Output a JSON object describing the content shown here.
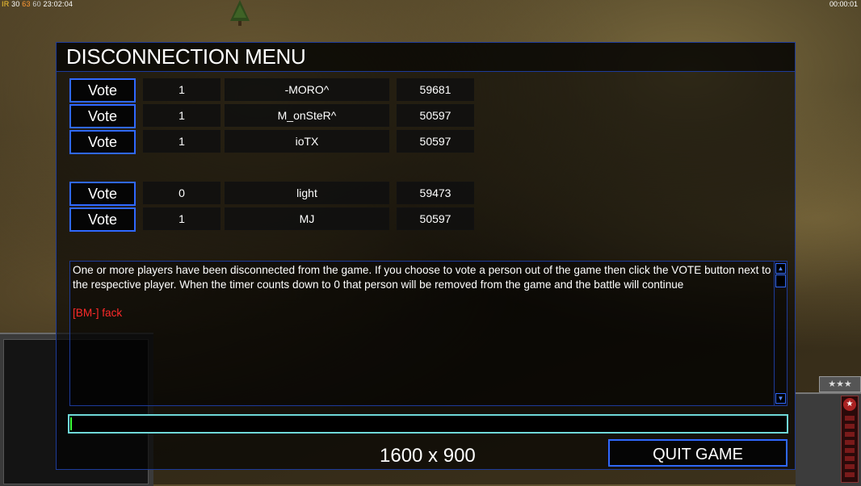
{
  "hud": {
    "stats": [
      "IR",
      "30",
      "63",
      "60",
      "23:02:04"
    ],
    "timer": "00:00:01",
    "rank_stars": "★★★"
  },
  "dialog": {
    "title": "DISCONNECTION MENU",
    "vote_label": "Vote",
    "players_group1": [
      {
        "votes": "1",
        "name": "-MORO^",
        "id": "59681"
      },
      {
        "votes": "1",
        "name": "M_onSteR^",
        "id": "50597"
      },
      {
        "votes": "1",
        "name": "ioTX",
        "id": "50597"
      }
    ],
    "players_group2": [
      {
        "votes": "0",
        "name": "light",
        "id": "59473"
      },
      {
        "votes": "1",
        "name": "MJ",
        "id": "50597"
      }
    ],
    "message": "One or more players have been disconnected from the game. If you choose to vote a person out of the game then click the VOTE button next to the respective player. When the timer counts down to 0 that person will be removed from the game and the battle will continue",
    "chat_line": "[BM-] fack",
    "chat_input_value": "",
    "resolution": "1600 x 900",
    "quit_label": "QUIT GAME"
  }
}
